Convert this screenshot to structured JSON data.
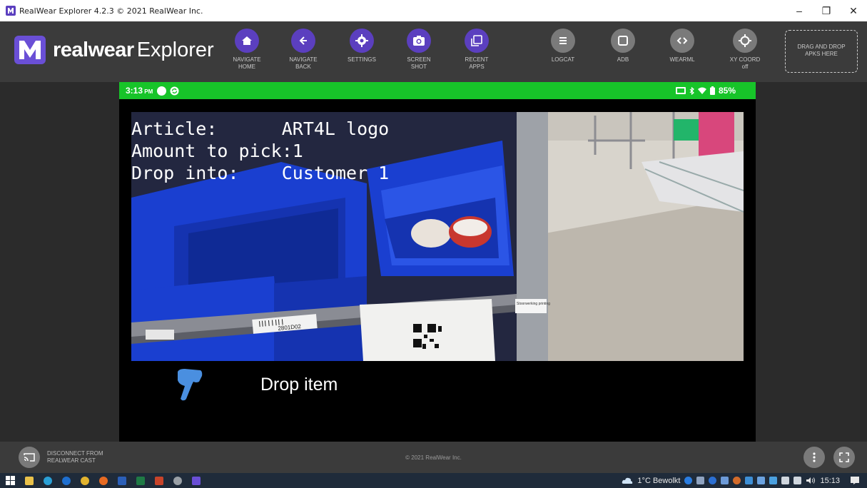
{
  "window": {
    "title": "RealWear Explorer 4.2.3 © 2021 RealWear Inc.",
    "minimize": "–",
    "maximize": "❐",
    "close": "✕"
  },
  "brand": {
    "bold": "realwear",
    "light": "Explorer"
  },
  "toolbar": {
    "navigate_home": "NAVIGATE\nHOME",
    "navigate_back": "NAVIGATE\nBACK",
    "settings": "SETTINGS",
    "screen_shot": "SCREEN\nSHOT",
    "recent_apps": "RECENT\nAPPS",
    "logcat": "LOGCAT",
    "adb": "ADB",
    "wearml": "WEARML",
    "xy_coord": "XY COORD",
    "xy_coord_state": "off",
    "dropzone": "DRAG AND DROP\nAPKS HERE"
  },
  "device": {
    "status": {
      "time": "3:13",
      "ampm": "PM",
      "battery": "85%"
    },
    "overlay": {
      "line1": "Article:      ART4L logo",
      "line2": "Amount to pick:1",
      "line3": "Drop into:    Customer 1"
    },
    "scene_labels": {
      "barcode_label": "2801D02",
      "shelf_tag": "Stoorwerking\nprinting"
    },
    "instruction": "Drop item"
  },
  "footer": {
    "cast_label": "DISCONNECT FROM\nREALWEAR CAST",
    "copyright": "© 2021 RealWear Inc."
  },
  "taskbar": {
    "weather": "1°C  Bewolkt",
    "clock": "15:13"
  },
  "colors": {
    "accent_purple": "#5b3fbf",
    "status_green": "#17c429",
    "toolbar_bg": "#3b3b3b",
    "bin_blue": "#1a3fd0"
  }
}
